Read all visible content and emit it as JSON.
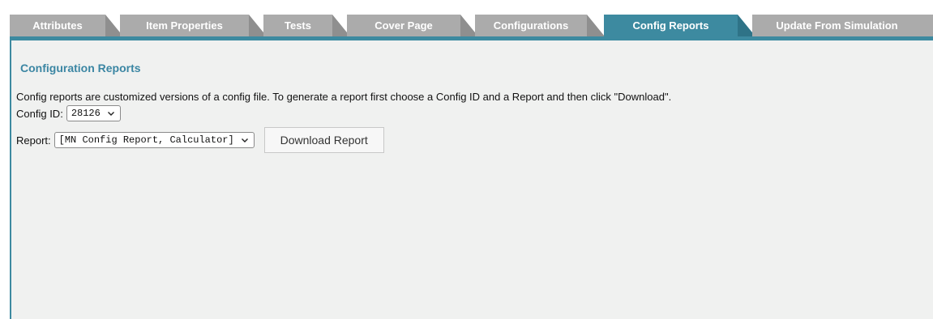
{
  "tabs": [
    {
      "label": "Attributes",
      "active": false
    },
    {
      "label": "Item Properties",
      "active": false
    },
    {
      "label": "Tests",
      "active": false
    },
    {
      "label": "Cover Page",
      "active": false
    },
    {
      "label": "Configurations",
      "active": false
    },
    {
      "label": "Config Reports",
      "active": true
    },
    {
      "label": "Update From Simulation",
      "active": false
    }
  ],
  "panel": {
    "title": "Configuration Reports",
    "description": "Config reports are customized versions of a config file. To generate a report first choose a Config ID and a Report and then click \"Download\".",
    "config_id": {
      "label": "Config ID:",
      "selected": "28126"
    },
    "report": {
      "label": "Report:",
      "selected": "[MN Config Report, Calculator]"
    },
    "download_button": "Download Report"
  },
  "colors": {
    "tab_active": "#3d8aa0",
    "tab_inactive": "#ababab",
    "panel_bg": "#f0f1f0",
    "title": "#3b86a3"
  }
}
